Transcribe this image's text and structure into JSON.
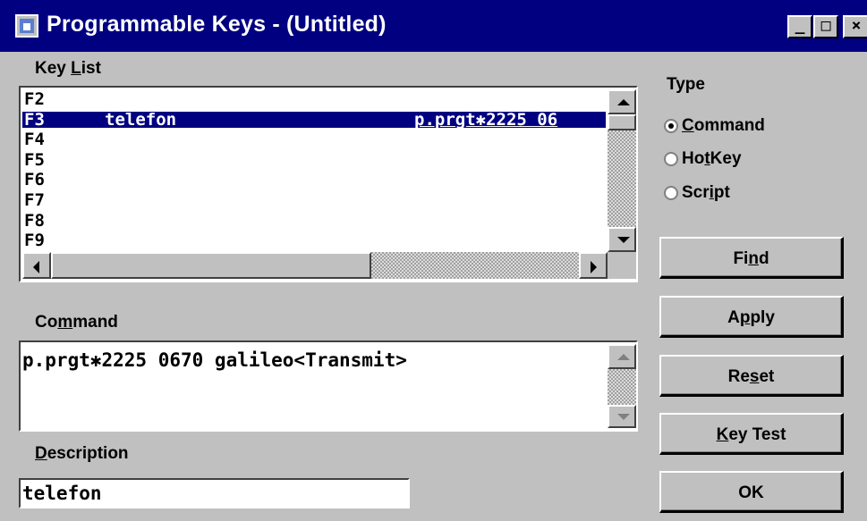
{
  "window": {
    "title": "Programmable Keys - (Untitled)",
    "controls": {
      "minimize": "_",
      "maximize": "□",
      "close": "×"
    }
  },
  "key_list": {
    "label_pre": "Key ",
    "label_mnemonic": "L",
    "label_post": "ist",
    "rows": [
      {
        "key": "F2",
        "description": "",
        "command": "",
        "selected": false
      },
      {
        "key": "F3",
        "description": "telefon",
        "command": "p.prgt✱2225 06",
        "selected": true
      },
      {
        "key": "F4",
        "description": "",
        "command": "",
        "selected": false
      },
      {
        "key": "F5",
        "description": "",
        "command": "",
        "selected": false
      },
      {
        "key": "F6",
        "description": "",
        "command": "",
        "selected": false
      },
      {
        "key": "F7",
        "description": "",
        "command": "",
        "selected": false
      },
      {
        "key": "F8",
        "description": "",
        "command": "",
        "selected": false
      },
      {
        "key": "F9",
        "description": "",
        "command": "",
        "selected": false
      }
    ]
  },
  "command": {
    "label_pre": "Co",
    "label_mnemonic": "m",
    "label_post": "mand",
    "value": "p.prgt✱2225 0670 galileo<Transmit>"
  },
  "description": {
    "label_mnemonic": "D",
    "label_post": "escription",
    "value": "telefon"
  },
  "type": {
    "label": "Type",
    "options": [
      {
        "pre": "",
        "mnemonic": "C",
        "post": "ommand",
        "checked": true
      },
      {
        "pre": "Ho",
        "mnemonic": "t",
        "post": "Key",
        "checked": false
      },
      {
        "pre": "Scr",
        "mnemonic": "i",
        "post": "pt",
        "checked": false
      }
    ]
  },
  "buttons": {
    "find": {
      "pre": "Fi",
      "mnemonic": "n",
      "post": "d"
    },
    "apply": {
      "pre": "A",
      "mnemonic": "p",
      "post": "ply"
    },
    "reset": {
      "pre": "Re",
      "mnemonic": "s",
      "post": "et"
    },
    "key_test": {
      "pre": "",
      "mnemonic": "K",
      "post": "ey Test"
    },
    "ok": {
      "pre": "OK",
      "mnemonic": "",
      "post": ""
    }
  },
  "colors": {
    "titlebar": "#000080",
    "selection": "#000080",
    "face": "#c0c0c0"
  }
}
